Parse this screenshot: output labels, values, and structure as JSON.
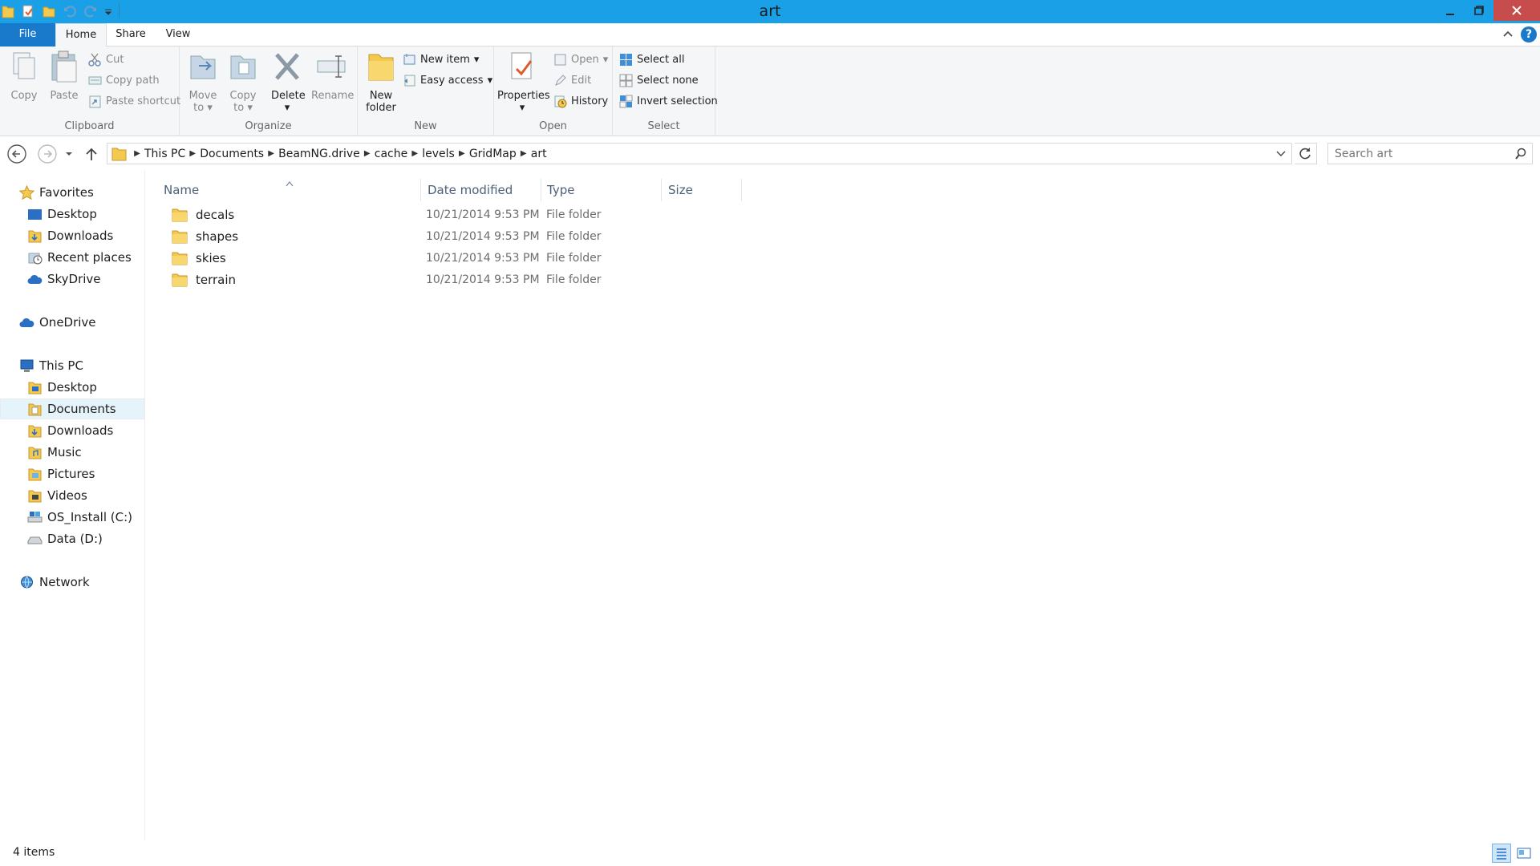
{
  "window": {
    "title": "art",
    "colors": {
      "titlebar": "#1aa0e6",
      "file_tab": "#1979ca",
      "close": "#c74c4c"
    }
  },
  "tabs": {
    "file": "File",
    "home": "Home",
    "share": "Share",
    "view": "View"
  },
  "ribbon": {
    "clipboard": {
      "label": "Clipboard",
      "copy": "Copy",
      "paste": "Paste",
      "cut": "Cut",
      "copy_path": "Copy path",
      "paste_shortcut": "Paste shortcut"
    },
    "organize": {
      "label": "Organize",
      "move_to_1": "Move",
      "move_to_2": "to",
      "copy_to_1": "Copy",
      "copy_to_2": "to",
      "delete": "Delete",
      "rename": "Rename"
    },
    "new": {
      "label": "New",
      "new_folder_1": "New",
      "new_folder_2": "folder",
      "new_item": "New item",
      "easy_access": "Easy access"
    },
    "open": {
      "label": "Open",
      "properties": "Properties",
      "open": "Open",
      "edit": "Edit",
      "history": "History"
    },
    "select": {
      "label": "Select",
      "select_all": "Select all",
      "select_none": "Select none",
      "invert_selection": "Invert selection"
    }
  },
  "address": {
    "crumbs": [
      "This PC",
      "Documents",
      "BeamNG.drive",
      "cache",
      "levels",
      "GridMap",
      "art"
    ],
    "search_placeholder": "Search art"
  },
  "nav": {
    "favorites": "Favorites",
    "fav_items": [
      "Desktop",
      "Downloads",
      "Recent places",
      "SkyDrive"
    ],
    "onedrive": "OneDrive",
    "this_pc": "This PC",
    "pc_items": [
      "Desktop",
      "Documents",
      "Downloads",
      "Music",
      "Pictures",
      "Videos",
      "OS_Install (C:)",
      "Data (D:)"
    ],
    "network": "Network"
  },
  "columns": {
    "name": "Name",
    "date": "Date modified",
    "type": "Type",
    "size": "Size"
  },
  "files": [
    {
      "name": "decals",
      "date": "10/21/2014 9:53 PM",
      "type": "File folder"
    },
    {
      "name": "shapes",
      "date": "10/21/2014 9:53 PM",
      "type": "File folder"
    },
    {
      "name": "skies",
      "date": "10/21/2014 9:53 PM",
      "type": "File folder"
    },
    {
      "name": "terrain",
      "date": "10/21/2014 9:53 PM",
      "type": "File folder"
    }
  ],
  "status": {
    "count": "4 items"
  }
}
